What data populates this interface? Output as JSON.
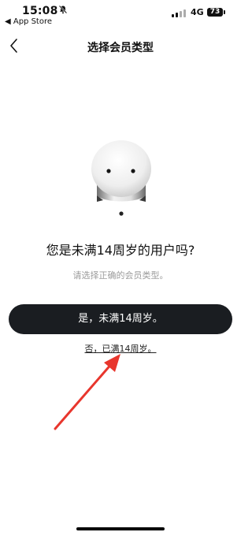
{
  "status_bar": {
    "time": "15:08",
    "back_app": "◀ App Store",
    "network": "4G",
    "battery": "73"
  },
  "nav": {
    "title": "选择会员类型"
  },
  "main": {
    "question": "您是未满14周岁的用户吗?",
    "hint": "请选择正确的会员类型。",
    "yes_button": "是，未满14周岁。",
    "no_link": "否，已满14周岁。"
  },
  "colors": {
    "primary_button": "#1a1d21",
    "annotation_arrow": "#e8362d",
    "hint_text": "#9b9b9b"
  },
  "icons": {
    "back": "chevron-left-icon",
    "silent": "bell-slash-icon",
    "mascot": "mascot-icon"
  }
}
